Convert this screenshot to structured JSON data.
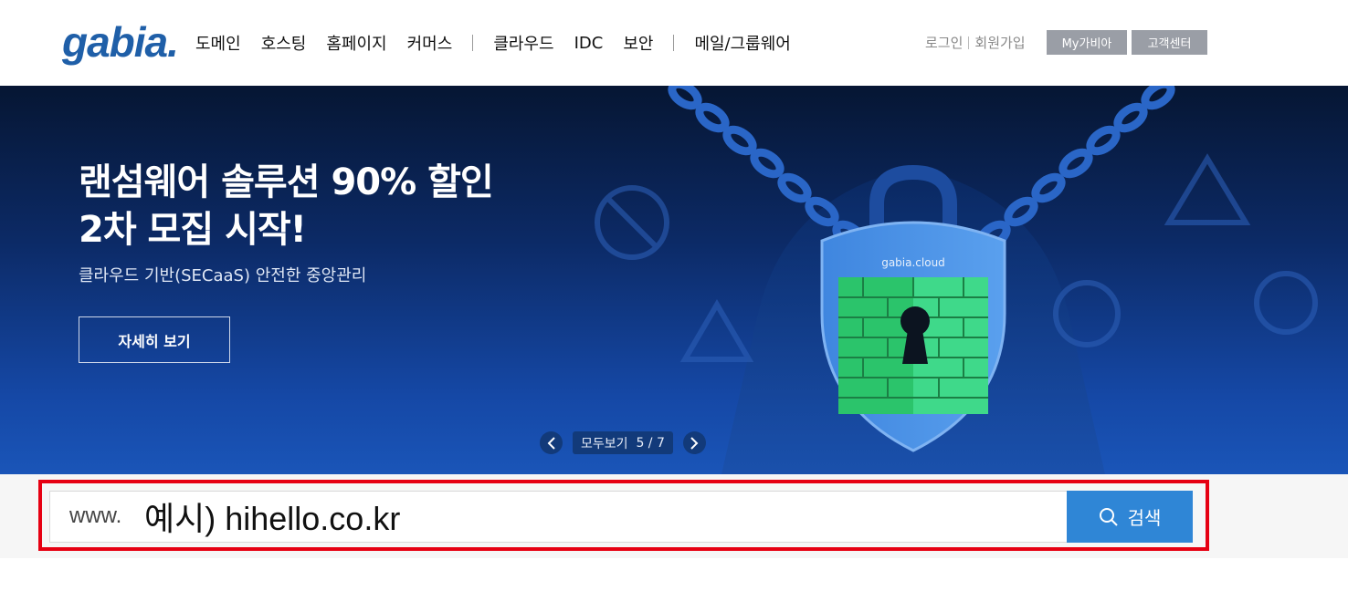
{
  "header": {
    "logo_text": "gabia.",
    "nav": [
      "도메인",
      "호스팅",
      "홈페이지",
      "커머스",
      "클라우드",
      "IDC",
      "보안",
      "메일/그룹웨어"
    ],
    "login": "로그인",
    "signup": "회원가입",
    "mygabia": "My가비아",
    "customer_center": "고객센터"
  },
  "banner": {
    "title_line1": "랜섬웨어 솔루션 90% 할인",
    "title_line2": "2차 모집 시작!",
    "subtitle": "클라우드 기반(SECaaS) 안전한 중앙관리",
    "cta": "자세히 보기",
    "shield_brand": "gabia.cloud",
    "pager_label": "모두보기",
    "pager_current": "5",
    "pager_total": "7"
  },
  "search": {
    "prefix": "www.",
    "value": "예시) hihello.co.kr",
    "button_label": "검색"
  },
  "colors": {
    "brand_blue": "#1f5fa8",
    "search_button": "#2f86d6",
    "highlight_frame": "#e60012"
  }
}
